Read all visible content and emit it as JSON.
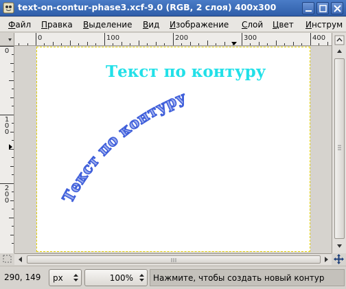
{
  "window": {
    "title": "text-on-contur-phase3.xcf-9.0 (RGB, 2 слоя) 400x300"
  },
  "menu": {
    "items": [
      "Файл",
      "Правка",
      "Выделение",
      "Вид",
      "Изображение",
      "Слой",
      "Цвет",
      "Инструм"
    ]
  },
  "rulers": {
    "horizontal": [
      "0",
      "100",
      "200",
      "300",
      "400"
    ],
    "vertical": [
      "0",
      "100",
      "200"
    ]
  },
  "canvas": {
    "straight_text": "Текст по контуру",
    "curved_text": "Текст по контуру",
    "colors": {
      "straight_text": "#22e0e8",
      "curved_text": "#3a5ad8",
      "background": "#ffffff",
      "boundary": "#c9b400"
    }
  },
  "statusbar": {
    "coords": "290, 149",
    "unit": "px",
    "zoom": "100%",
    "message": "Нажмите, чтобы создать новый контур"
  },
  "icons": {
    "app": "gimp-app-icon",
    "minimize": "minimize-icon",
    "maximize": "maximize-icon",
    "close": "close-icon",
    "quickmask": "quick-mask-icon",
    "navigate": "navigate-icon"
  }
}
